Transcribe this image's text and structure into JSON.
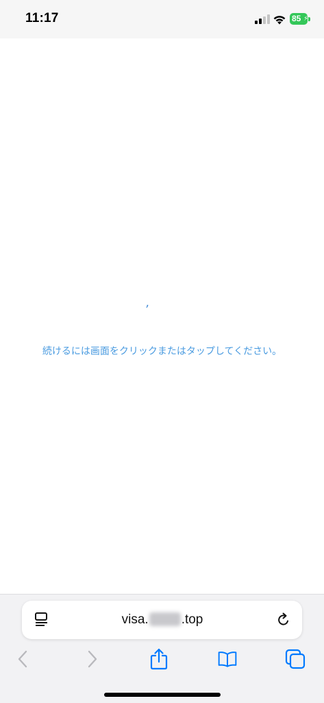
{
  "status_bar": {
    "time": "11:17",
    "battery_level": "85",
    "icons": [
      "cellular-signal-icon",
      "wifi-icon",
      "battery-icon"
    ]
  },
  "content": {
    "quote_mark": "’",
    "continue_text": "続けるには画面をクリックまたはタップしてください。"
  },
  "address_bar": {
    "url_prefix": "visa.",
    "url_suffix": ".top",
    "icons": [
      "reader-view-icon",
      "reload-icon"
    ]
  },
  "toolbar": {
    "icons": [
      "back-icon",
      "forward-icon",
      "share-icon",
      "bookmarks-icon",
      "tabs-icon"
    ]
  },
  "colors": {
    "accent": "#007aff",
    "battery": "#34c759",
    "link_text": "#4a9be0",
    "disabled": "#b9b9bd"
  }
}
